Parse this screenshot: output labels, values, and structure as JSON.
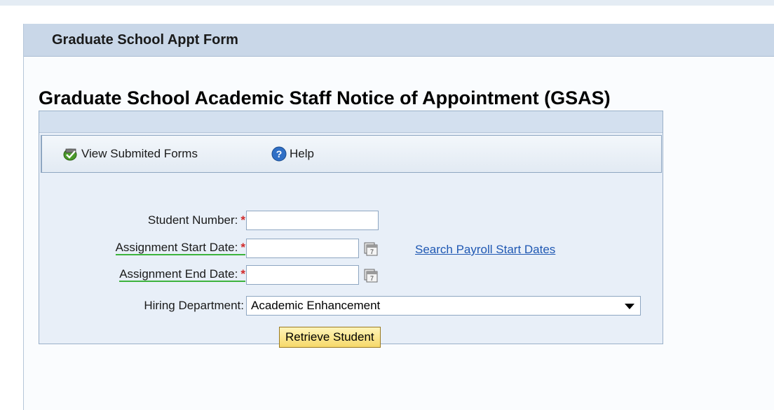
{
  "header": {
    "title": "Graduate School Appt Form"
  },
  "page": {
    "title": "Graduate School Academic Staff Notice of Appointment (GSAS)"
  },
  "toolbar": {
    "view_submitted_label": "View Submited Forms",
    "help_label": "Help"
  },
  "form": {
    "required_marker": "*",
    "student_number": {
      "label": "Student Number:",
      "value": ""
    },
    "start_date": {
      "label": "Assignment Start Date:",
      "value": ""
    },
    "end_date": {
      "label": "Assignment End Date:",
      "value": ""
    },
    "search_link": "Search Payroll Start Dates",
    "hiring_department": {
      "label": "Hiring Department:",
      "selected": "Academic Enhancement"
    },
    "retrieve_button": "Retrieve Student"
  },
  "colors": {
    "header_bg": "#c9d7e8",
    "panel_bg": "#e8eff8",
    "required": "#d12a2a",
    "link": "#1f58b3",
    "button_bg": "#f6d96a"
  },
  "icons": [
    "check-shield-icon",
    "help-icon",
    "calendar-icon",
    "chevron-down-icon"
  ]
}
